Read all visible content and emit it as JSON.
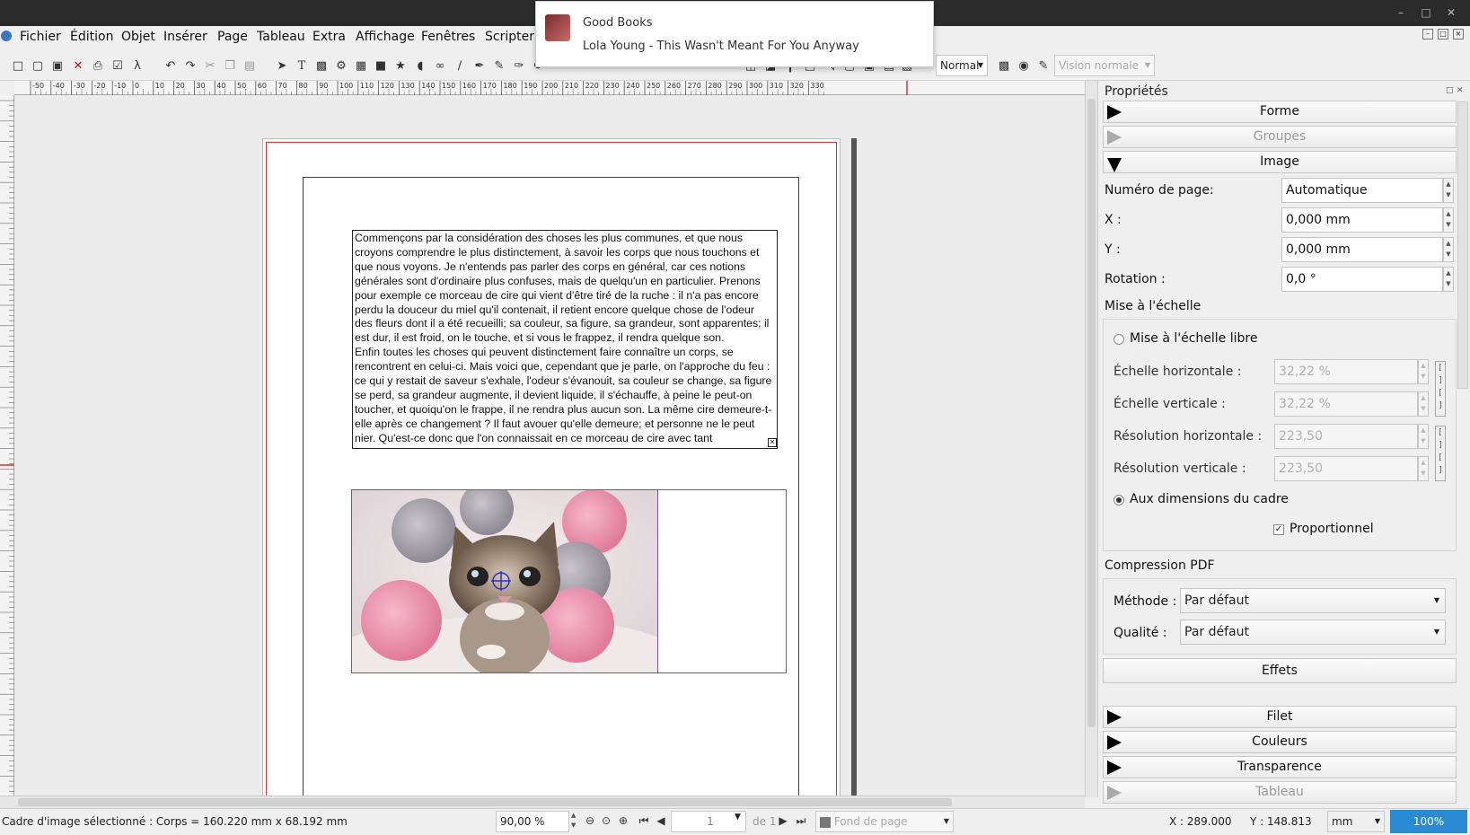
{
  "notification": {
    "app": "Good Books",
    "body": "Lola Young - This Wasn't Meant For You Anyway"
  },
  "menu": [
    "Fichier",
    "Édition",
    "Objet",
    "Insérer",
    "Page",
    "Tableau",
    "Extra",
    "Affichage",
    "Fenêtres",
    "Scripter"
  ],
  "toolbar": {
    "blend_mode": "Normal",
    "view_mode": "Vision normale"
  },
  "ruler_ticks": [
    "-50",
    "-40",
    "-30",
    "-20",
    "-10",
    "0",
    "10",
    "20",
    "30",
    "40",
    "50",
    "60",
    "70",
    "80",
    "90",
    "100",
    "110",
    "120",
    "130",
    "140",
    "150",
    "160",
    "170",
    "180",
    "190",
    "200",
    "210",
    "220",
    "230",
    "240",
    "250",
    "260",
    "270",
    "280",
    "290",
    "300",
    "310",
    "320",
    "330"
  ],
  "document": {
    "text": "Commençons par la considération des choses les plus communes, et que nous croyons comprendre le plus distinctement, à savoir les corps que nous touchons et que nous voyons. Je n'entends pas parler des corps en général, car ces notions générales sont d'ordinaire plus confuses, mais de quelqu'un en particulier. Prenons pour exemple ce morceau de cire qui vient d'être tiré de la ruche : il n'a pas encore perdu la douceur du miel qu'il contenait, il retient encore quelque chose de l'odeur des fleurs dont il a été recueilli; sa couleur, sa figure, sa grandeur, sont apparentes; il est dur, il est froid, on le touche, et si vous le frappez, il rendra quelque son.\nEnfin toutes les choses qui peuvent distinctement faire connaître un corps, se rencontrent en celui-ci. Mais voici que, cependant que je parle, on l'approche du feu : ce qui y restait de saveur s'exhale, l'odeur s'évanouit, sa couleur se change, sa figure se perd, sa grandeur augmente, il devient liquide, il s'échauffe, à peine le peut-on toucher, et quoiqu'on le frappe, il ne rendra plus aucun son. La même cire demeure-t-elle après ce changement ? Il faut avouer qu'elle demeure; et personne ne le peut nier. Qu'est-ce donc que l'on connaissait en ce morceau de cire avec tant"
  },
  "panel": {
    "title": "Propriétés",
    "sections": {
      "forme": "Forme",
      "groupes": "Groupes",
      "image": "Image",
      "effets": "Effets",
      "filet": "Filet",
      "couleurs": "Couleurs",
      "transparence": "Transparence",
      "tableau": "Tableau"
    },
    "page_label": "Numéro de page:",
    "page_value": "Automatique",
    "x_label": "X :",
    "x_value": "0,000 mm",
    "y_label": "Y :",
    "y_value": "0,000 mm",
    "rot_label": "Rotation :",
    "rot_value": "0,0 °",
    "scaling_title": "Mise à l'échelle",
    "free_scale": "Mise à l'échelle libre",
    "hscale_label": "Échelle horizontale :",
    "hscale_value": "32,22 %",
    "vscale_label": "Échelle verticale :",
    "vscale_value": "32,22 %",
    "hres_label": "Résolution horizontale :",
    "hres_value": "223,50",
    "vres_label": "Résolution verticale :",
    "vres_value": "223,50",
    "frame_dims": "Aux dimensions du cadre",
    "proportional": "Proportionnel",
    "pdf_title": "Compression PDF",
    "method_label": "Méthode :",
    "method_value": "Par défaut",
    "quality_label": "Qualité :",
    "quality_value": "Par défaut"
  },
  "status": {
    "selection": "Cadre d'image sélectionné : Corps = 160.220 mm x 68.192 mm",
    "zoom": "90,00 %",
    "page": "1",
    "of": "de 1",
    "layer": "Fond de page",
    "x": "X : 289.000",
    "y": "Y : 148.813",
    "unit": "mm",
    "zoom_btn": "100%"
  },
  "colors": {
    "accent": "#2a8ad4",
    "frame_red": "#e03030",
    "margin_blue": "#3030c0"
  }
}
